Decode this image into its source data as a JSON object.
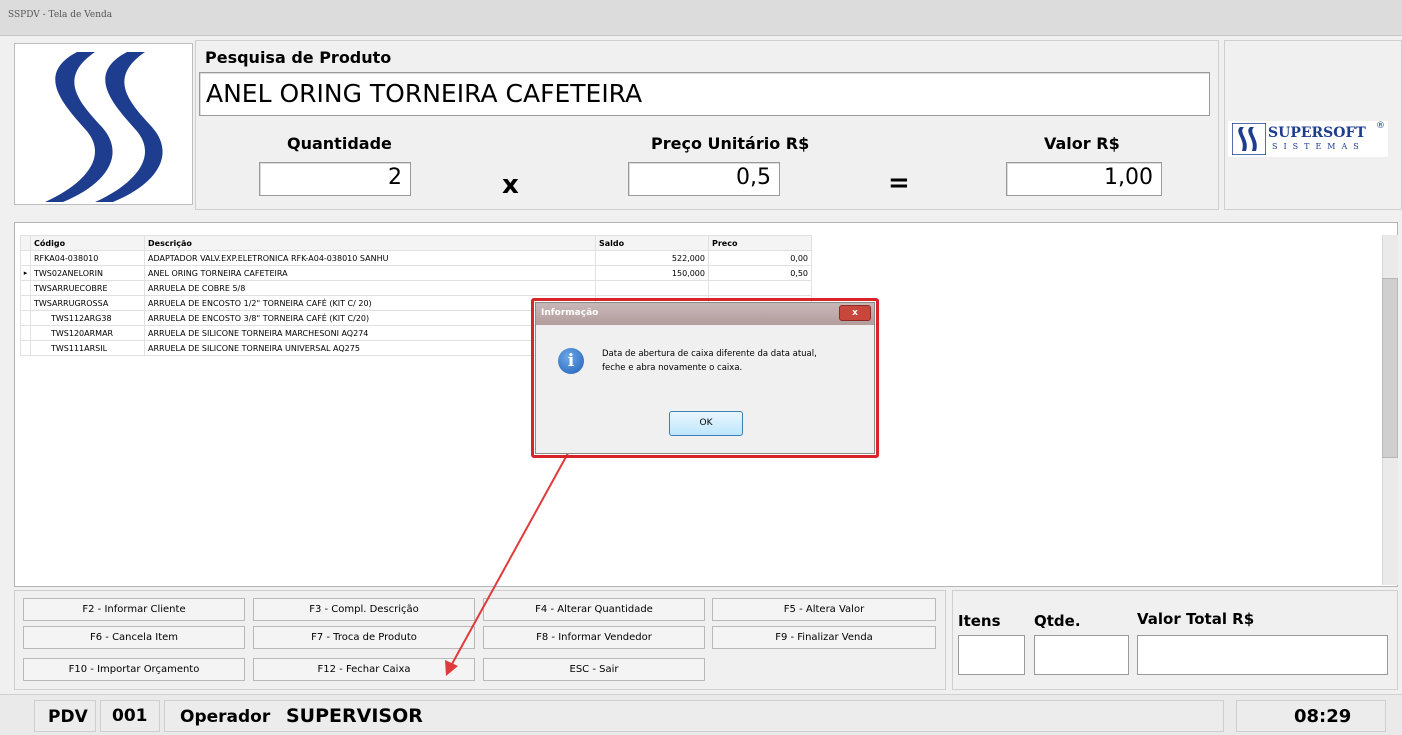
{
  "window": {
    "title": "SSPDV - Tela de Venda"
  },
  "search": {
    "label": "Pesquisa de Produto",
    "value": "ANEL ORING TORNEIRA CAFETEIRA"
  },
  "quantity": {
    "label": "Quantidade",
    "value": "2"
  },
  "unit_price": {
    "label": "Preço Unitário R$",
    "value": "0,5"
  },
  "total_value": {
    "label": "Valor R$",
    "value": "1,00"
  },
  "operators": {
    "times": "x",
    "equals": "="
  },
  "brand": {
    "name": "SUPERSOFT",
    "sub": "SISTEMAS",
    "reg": "®"
  },
  "grid": {
    "headers": [
      "Código",
      "Descrição",
      "Saldo",
      "Preco"
    ],
    "rows": [
      [
        "RFKA04-038010",
        "ADAPTADOR VALV.EXP.ELETRONICA RFK-A04-038010 SANHU",
        "522,000",
        "0,00"
      ],
      [
        "TWS02ANELORIN",
        "ANEL ORING TORNEIRA CAFETEIRA",
        "150,000",
        "0,50"
      ],
      [
        "TWSARRUECOBRE",
        "ARRUELA DE COBRE 5/8",
        "",
        ""
      ],
      [
        "TWSARRUGROSSA",
        "ARRUELA DE ENCOSTO 1/2\" TORNEIRA CAFÉ (KIT C/ 20)",
        "",
        ""
      ],
      [
        "TWS112ARG38",
        "ARRUELA DE ENCOSTO 3/8\" TORNEIRA CAFÉ (KIT C/20)",
        "",
        ""
      ],
      [
        "TWS120ARMAR",
        "ARRUELA DE SILICONE TORNEIRA MARCHESONI AQ274",
        "",
        ""
      ],
      [
        "TWS111ARSIL",
        "ARRUELA DE SILICONE TORNEIRA UNIVERSAL AQ275",
        "",
        ""
      ]
    ],
    "selected_marker": "▸"
  },
  "function_keys": {
    "f2": "F2 - Informar Cliente",
    "f3": "F3 - Compl. Descrição",
    "f4": "F4 - Alterar Quantidade",
    "f5": "F5 - Altera Valor",
    "f6": "F6 - Cancela Item",
    "f7": "F7 - Troca de Produto",
    "f8": "F8 - Informar Vendedor",
    "f9": "F9 - Finalizar Venda",
    "f10": "F10 - Importar Orçamento",
    "f12": "F12 - Fechar Caixa",
    "esc": "ESC - Sair"
  },
  "totals": {
    "items_label": "Itens",
    "qty_label": "Qtde.",
    "total_label": "Valor Total R$"
  },
  "status": {
    "pdv_label": "PDV",
    "pdv_value": "001",
    "operator_label": "Operador",
    "operator_value": "SUPERVISOR",
    "time": "08:29"
  },
  "dialog": {
    "title": "Informação",
    "close": "x",
    "info_glyph": "i",
    "message_line1": "Data de abertura de caixa diferente da data atual,",
    "message_line2": "feche e abra novamente o caixa.",
    "ok": "OK"
  },
  "colors": {
    "highlight": "#d9232a",
    "brand_blue": "#1f3d8f"
  }
}
